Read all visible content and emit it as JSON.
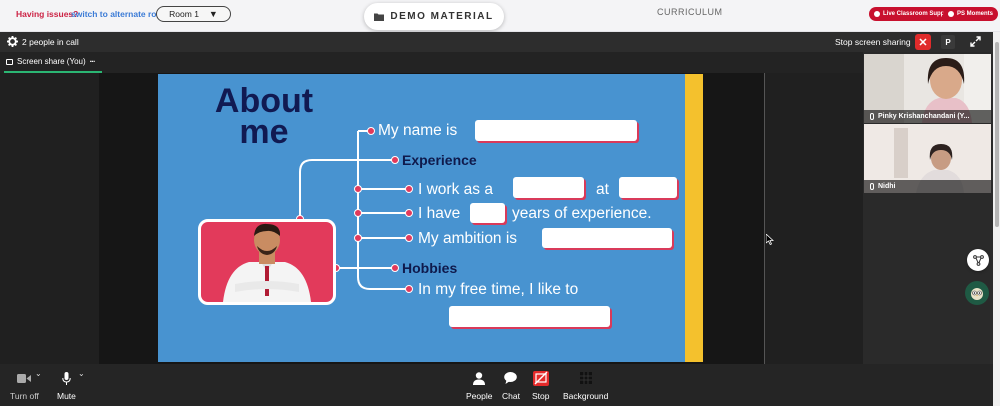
{
  "topbar": {
    "issue_text": "Having issues?",
    "alt_room_link": "switch to alternate room",
    "room_select": "Room 1",
    "demo_button": "DEMO MATERIAL",
    "curriculum": "CURRICULUM",
    "live_support": "Live Classroom Support",
    "ps_moments": "PS Moments"
  },
  "call": {
    "people_count": "2 people in call",
    "stop_sharing": "Stop screen sharing",
    "p_badge": "P",
    "screen_share_tab": "Screen share (You)",
    "more_glyph": "···"
  },
  "slide": {
    "title_line1": "About",
    "title_line2": "me",
    "my_name": "My name is",
    "experience": "Experience",
    "work_as": "I work as a",
    "at": "at",
    "i_have": "I have",
    "years": "years of experience.",
    "ambition": "My ambition is",
    "hobbies": "Hobbies",
    "free_time": "In my free time, I like to"
  },
  "participants": [
    {
      "name": "Pinky Krishanchandani (Y..."
    },
    {
      "name": "Nidhi"
    }
  ],
  "toolbar": {
    "camera": "Turn off",
    "mute": "Mute",
    "people": "People",
    "chat": "Chat",
    "stop": "Stop",
    "background": "Background"
  },
  "colors": {
    "slide_bg": "#4893d0",
    "accent_red": "#e23a5b",
    "navy": "#111a52",
    "yellow": "#f4c12d",
    "brand_red": "#c8102e",
    "active_green": "#2bb673"
  }
}
